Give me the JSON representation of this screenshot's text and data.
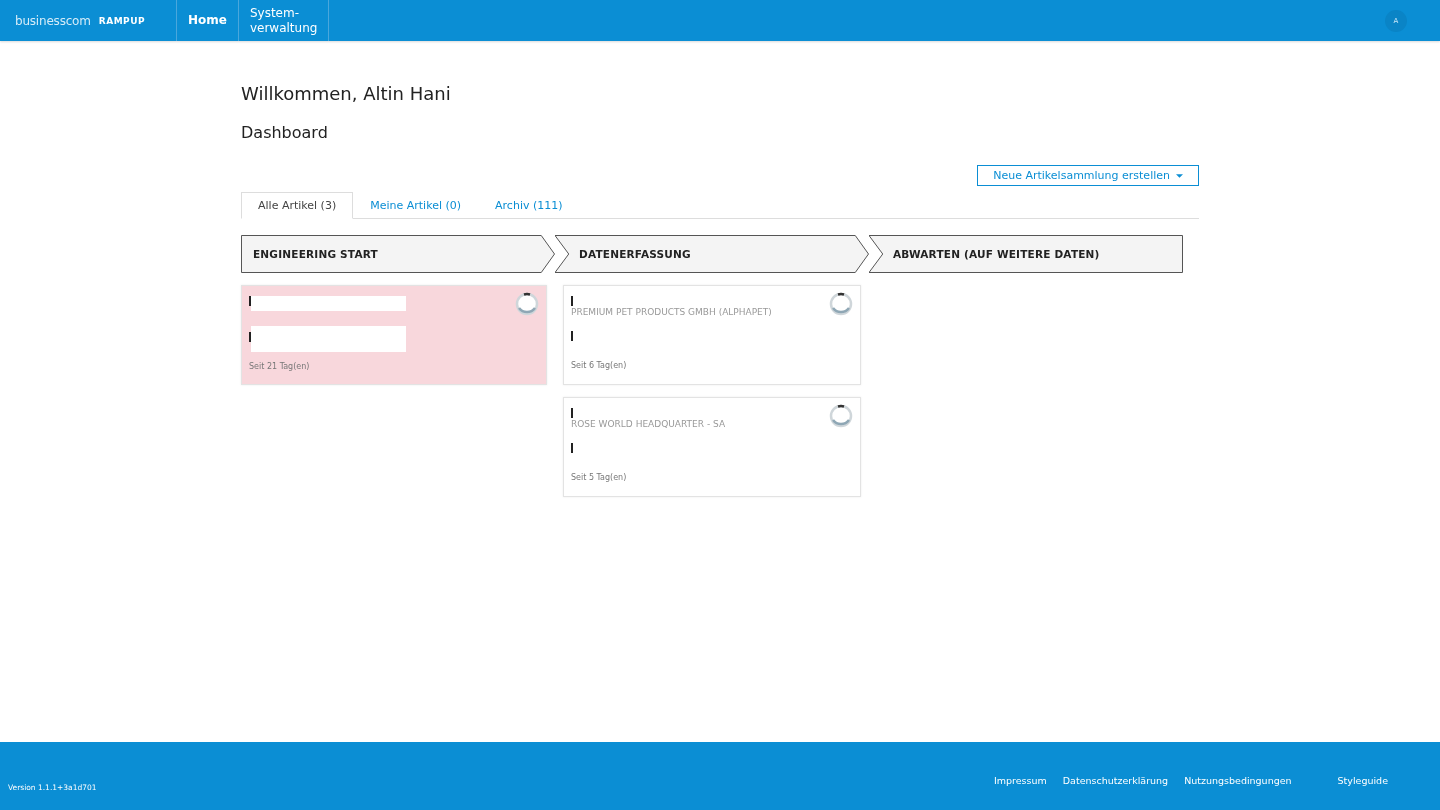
{
  "header": {
    "logo_word": "businesscom",
    "logo_product": "RAMPUP",
    "nav": [
      {
        "label": "Home",
        "selected": true
      },
      {
        "label": "System-\nverwaltung",
        "selected": false
      }
    ],
    "avatar": "A"
  },
  "greeting": "Willkommen, Altin Hani",
  "section_title": "Dashboard",
  "create_button": "Neue Artikelsammlung erstellen",
  "tabs": [
    {
      "label": "Alle Artikel (3)",
      "selected": true
    },
    {
      "label": "Meine Artikel (0)",
      "selected": false
    },
    {
      "label": "Archiv (111)",
      "selected": false
    }
  ],
  "stages": [
    {
      "label": "ENGINEERING START",
      "cards": [
        {
          "age": "Seit 21 Tag(en)",
          "highlighted": true,
          "redacted": true
        }
      ]
    },
    {
      "label": "DATENERFASSUNG",
      "cards": [
        {
          "company": "PREMIUM PET PRODUCTS GMBH (ALPHAPET)",
          "age": "Seit 6 Tag(en)",
          "highlighted": false,
          "redacted": false
        },
        {
          "company": "ROSE WORLD HEADQUARTER - SA",
          "age": "Seit 5 Tag(en)",
          "highlighted": false,
          "redacted": false
        }
      ]
    },
    {
      "label": "ABWARTEN (AUF WEITERE DATEN)"
    }
  ],
  "footer": {
    "version": "Version 1.1.1+3a1d701",
    "links": [
      "Impressum",
      "Datenschutzerklärung",
      "Nutzungsbedingungen",
      "Styleguide"
    ]
  }
}
